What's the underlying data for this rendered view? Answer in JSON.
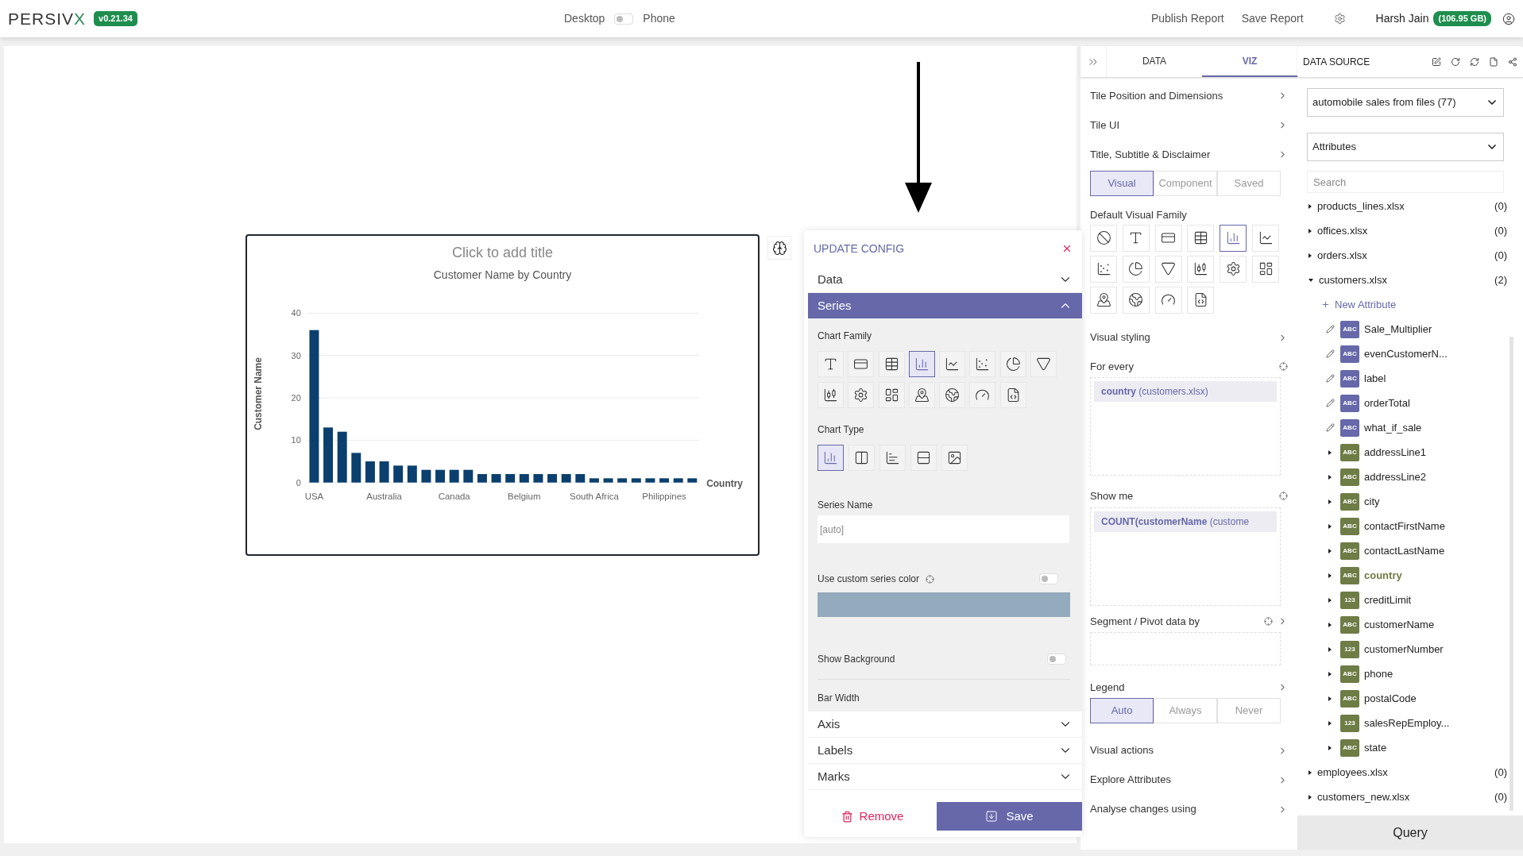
{
  "header": {
    "logo": "PERSIV",
    "logo_accent": "X",
    "version": "v0.21.34",
    "view_switch": {
      "left_label": "Desktop",
      "right_label": "Phone",
      "on": false
    },
    "actions": [
      "Publish Report",
      "Save Report"
    ],
    "user_name": "Harsh Jain",
    "storage": "(106.95 GB)"
  },
  "chart_tile": {
    "title": "Click to add title",
    "subtitle": "Customer Name by Country",
    "chart_data": {
      "type": "bar",
      "xlabel": "Country",
      "ylabel": "Customer Name",
      "categories": [
        "USA",
        null,
        null,
        null,
        null,
        "Australia",
        null,
        null,
        null,
        null,
        "Canada",
        null,
        null,
        null,
        null,
        "Belgium",
        null,
        null,
        null,
        null,
        "South Africa",
        null,
        null,
        null,
        null,
        "Philippines",
        null,
        null
      ],
      "series": [
        {
          "color": "#0a3f6e",
          "values": [
            36,
            13,
            12,
            7,
            5,
            5,
            4,
            4,
            3,
            3,
            3,
            3,
            2,
            2,
            2,
            2,
            2,
            2,
            2,
            2,
            1,
            1,
            1,
            1,
            1,
            1,
            1,
            1
          ]
        }
      ],
      "ylim": [
        0,
        40
      ],
      "yticks": [
        0,
        10,
        20,
        30,
        40
      ],
      "grid": true
    }
  },
  "update_config": {
    "title": "UPDATE CONFIG",
    "sections": [
      {
        "label": "Data",
        "expanded": false
      },
      {
        "label": "Series",
        "expanded": true
      },
      {
        "label": "Axis",
        "expanded": false
      },
      {
        "label": "Labels",
        "expanded": false
      },
      {
        "label": "Marks",
        "expanded": false
      }
    ],
    "series_settings": {
      "chart_family_label": "Chart Family",
      "chart_family": [
        {
          "kind": "text",
          "selected": false
        },
        {
          "kind": "card",
          "selected": false
        },
        {
          "kind": "table",
          "selected": false
        },
        {
          "kind": "bar",
          "selected": true
        },
        {
          "kind": "line",
          "selected": false
        },
        {
          "kind": "scatter",
          "selected": false
        },
        {
          "kind": "pie",
          "selected": false
        },
        {
          "kind": "funnel",
          "selected": false
        },
        {
          "kind": "candlestick",
          "selected": false
        },
        {
          "kind": "gear",
          "selected": false
        },
        {
          "kind": "grid",
          "selected": false
        },
        {
          "kind": "map",
          "selected": false
        },
        {
          "kind": "globe",
          "selected": false
        },
        {
          "kind": "gauge",
          "selected": false
        },
        {
          "kind": "script",
          "selected": false
        }
      ],
      "chart_type_label": "Chart Type",
      "chart_types": [
        {
          "kind": "bar",
          "selected": true
        },
        {
          "kind": "columns",
          "selected": false
        },
        {
          "kind": "horizontal",
          "selected": false
        },
        {
          "kind": "rows",
          "selected": false
        },
        {
          "kind": "image",
          "selected": false
        }
      ],
      "series_name_label": "Series Name",
      "series_name_placeholder": "[auto]",
      "custom_color": {
        "label": "Use custom series color",
        "on": false,
        "color": "#94aabd"
      },
      "show_background": {
        "label": "Show Background",
        "on": false
      },
      "bar_width_label": "Bar Width"
    },
    "remove_label": "Remove",
    "save_label": "Save"
  },
  "viz_panel": {
    "tabs": [
      {
        "label": "DATA",
        "selected": false
      },
      {
        "label": "VIZ",
        "selected": true
      }
    ],
    "rows": [
      "Tile Position and Dimensions",
      "Tile UI",
      "Title, Subtitle & Disclaimer"
    ],
    "mode_tabs": [
      {
        "label": "Visual",
        "selected": true
      },
      {
        "label": "Component",
        "selected": false
      },
      {
        "label": "Saved",
        "selected": false
      }
    ],
    "family_label": "Default Visual Family",
    "family": [
      {
        "kind": "none",
        "selected": false
      },
      {
        "kind": "text",
        "selected": false
      },
      {
        "kind": "card",
        "selected": false
      },
      {
        "kind": "table",
        "selected": false
      },
      {
        "kind": "bar",
        "selected": true
      },
      {
        "kind": "line",
        "selected": false
      },
      {
        "kind": "scatter",
        "selected": false
      },
      {
        "kind": "pie",
        "selected": false
      },
      {
        "kind": "funnel",
        "selected": false
      },
      {
        "kind": "candlestick",
        "selected": false
      },
      {
        "kind": "gear",
        "selected": false
      },
      {
        "kind": "grid",
        "selected": false
      },
      {
        "kind": "map",
        "selected": false
      },
      {
        "kind": "globe",
        "selected": false
      },
      {
        "kind": "gauge",
        "selected": false
      },
      {
        "kind": "script",
        "selected": false
      }
    ],
    "visual_styling": "Visual styling",
    "for_every": {
      "label": "For every",
      "chips": [
        {
          "name": "country",
          "source": "(customers.xlsx)"
        }
      ]
    },
    "show_me": {
      "label": "Show me",
      "chips": [
        {
          "name": "COUNT(customerName",
          "source": "(custome"
        }
      ]
    },
    "segment_label": "Segment / Pivot data by",
    "legend": {
      "label": "Legend",
      "options": [
        {
          "label": "Auto",
          "selected": true
        },
        {
          "label": "Always",
          "selected": false
        },
        {
          "label": "Never",
          "selected": false
        }
      ]
    },
    "bottom_rows": [
      "Visual actions",
      "Explore Attributes",
      "Analyse changes using"
    ]
  },
  "data_source": {
    "title": "DATA SOURCE",
    "source_select": "automobile sales from files (77)",
    "view_select": "Attributes",
    "search_placeholder": "Search",
    "tables": [
      {
        "name": "products_lines.xlsx",
        "count": "(0)",
        "expanded": false
      },
      {
        "name": "offices.xlsx",
        "count": "(0)",
        "expanded": false
      },
      {
        "name": "orders.xlsx",
        "count": "(0)",
        "expanded": false
      },
      {
        "name": "customers.xlsx",
        "count": "(2)",
        "expanded": true,
        "new_attribute": "New Attribute",
        "attributes": [
          {
            "kind": "custom",
            "type": "ABC",
            "name": "Sale_Multiplier",
            "selected": false
          },
          {
            "kind": "custom",
            "type": "ABC",
            "name": "evenCustomerN...",
            "selected": false
          },
          {
            "kind": "custom",
            "type": "ABC",
            "name": "label",
            "selected": false
          },
          {
            "kind": "custom",
            "type": "ABC",
            "name": "orderTotal",
            "selected": false
          },
          {
            "kind": "custom",
            "type": "ABC",
            "name": "what_if_sale",
            "selected": false
          },
          {
            "kind": "field",
            "type": "ABC",
            "name": "addressLine1",
            "selected": false
          },
          {
            "kind": "field",
            "type": "ABC",
            "name": "addressLine2",
            "selected": false
          },
          {
            "kind": "field",
            "type": "ABC",
            "name": "city",
            "selected": false
          },
          {
            "kind": "field",
            "type": "ABC",
            "name": "contactFirstName",
            "selected": false
          },
          {
            "kind": "field",
            "type": "ABC",
            "name": "contactLastName",
            "selected": false
          },
          {
            "kind": "field",
            "type": "ABC",
            "name": "country",
            "selected": true
          },
          {
            "kind": "field",
            "type": "123",
            "name": "creditLimit",
            "selected": false
          },
          {
            "kind": "field",
            "type": "ABC",
            "name": "customerName",
            "selected": false
          },
          {
            "kind": "field",
            "type": "123",
            "name": "customerNumber",
            "selected": false
          },
          {
            "kind": "field",
            "type": "ABC",
            "name": "phone",
            "selected": false
          },
          {
            "kind": "field",
            "type": "ABC",
            "name": "postalCode",
            "selected": false
          },
          {
            "kind": "field",
            "type": "123",
            "name": "salesRepEmploy...",
            "selected": false
          },
          {
            "kind": "field",
            "type": "ABC",
            "name": "state",
            "selected": false
          }
        ]
      },
      {
        "name": "employees.xlsx",
        "count": "(0)",
        "expanded": false
      },
      {
        "name": "customers_new.xlsx",
        "count": "(0)",
        "expanded": false
      }
    ],
    "query_button": "Query"
  }
}
